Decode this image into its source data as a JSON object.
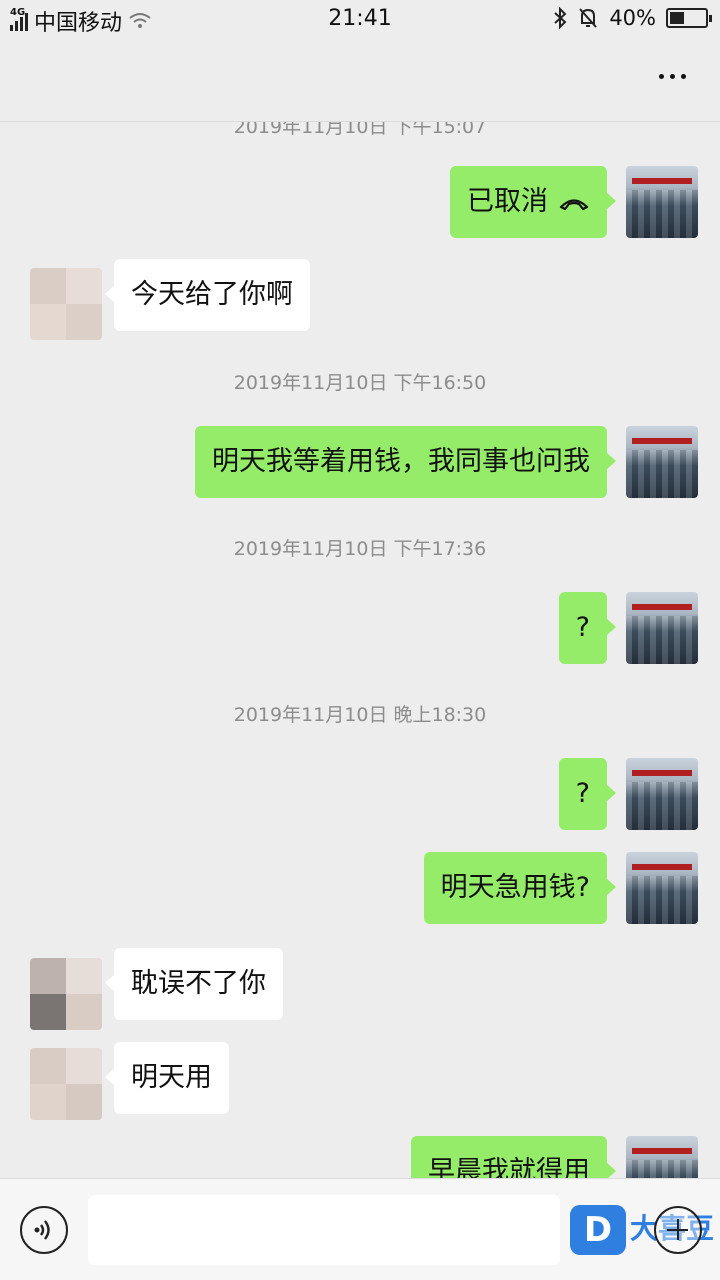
{
  "status_bar": {
    "network_type": "4G",
    "carrier": "中国移动",
    "time": "21:41",
    "battery_percent": "40%",
    "battery_level": 0.4
  },
  "header": {
    "more_icon": "more-dots-icon"
  },
  "chat": {
    "top_timestamp": "2019年11月10日 下午15:07",
    "messages": {
      "m1": {
        "text": "已取消",
        "icon": "hangup-icon"
      },
      "m2": {
        "text": "今天给了你啊"
      },
      "t1": "2019年11月10日 下午16:50",
      "m3": {
        "text": "明天我等着用钱，我同事也问我"
      },
      "t2": "2019年11月10日 下午17:36",
      "m4": {
        "text": "?"
      },
      "t3": "2019年11月10日 晚上18:30",
      "m5": {
        "text": "?"
      },
      "m6": {
        "text": "明天急用钱?"
      },
      "m7": {
        "text": "耽误不了你"
      },
      "m8": {
        "text": "明天用"
      },
      "m9": {
        "text": "早晨我就得用"
      }
    }
  },
  "bottom_bar": {
    "voice_icon": "voice-icon",
    "input_value": "",
    "watermark_logo": "D",
    "watermark_text": "大喜豆",
    "plus_icon": "plus-icon"
  },
  "colors": {
    "outgoing_bubble": "#95ec69",
    "incoming_bubble": "#ffffff",
    "background": "#ededed",
    "timestamp_text": "#8c8c8c",
    "watermark": "#2f7fe0"
  }
}
